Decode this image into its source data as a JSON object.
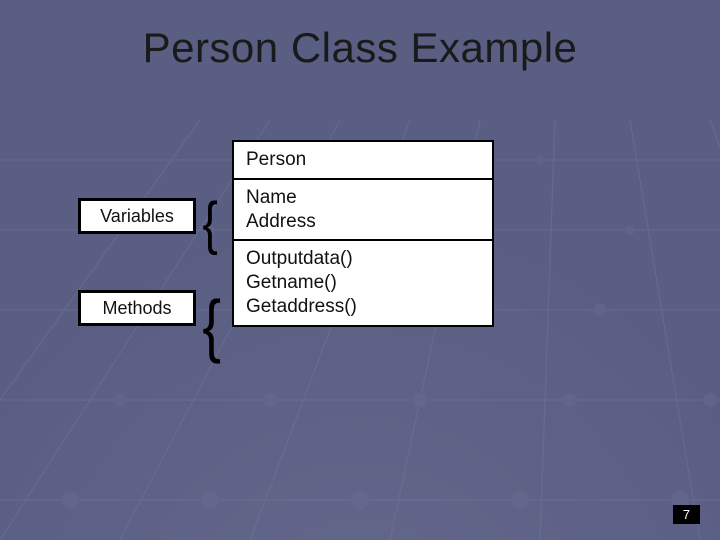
{
  "title": "Person Class Example",
  "annotations": {
    "variables_label": "Variables",
    "methods_label": "Methods"
  },
  "uml": {
    "class_name": "Person",
    "attributes": [
      "Name",
      "Address"
    ],
    "methods": [
      "Outputdata()",
      "Getname()",
      "Getaddress()"
    ]
  },
  "page_number": "7",
  "colors": {
    "background": "#5a5e83",
    "box_bg": "#ffffff",
    "box_border": "#000000",
    "text": "#111111"
  }
}
